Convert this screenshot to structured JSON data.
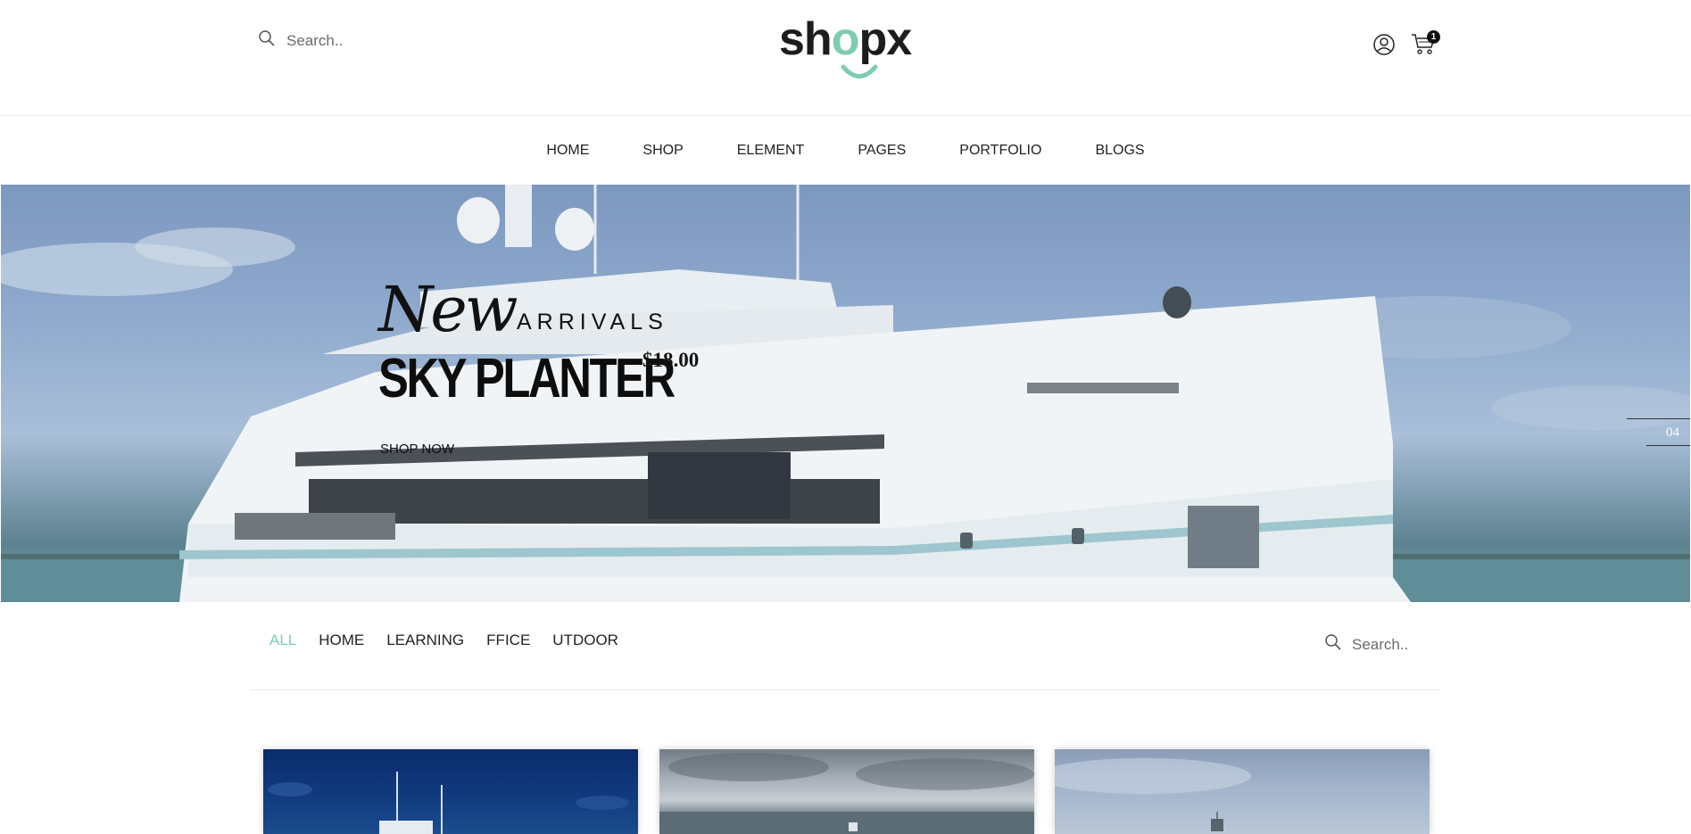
{
  "header": {
    "search_placeholder": "Search..",
    "logo_text": "shopx",
    "cart_count": "1",
    "icons": {
      "search": "search-icon",
      "account": "user-circle-icon",
      "cart": "cart-icon"
    }
  },
  "nav": {
    "items": [
      {
        "label": "HOME"
      },
      {
        "label": "SHOP"
      },
      {
        "label": "ELEMENT"
      },
      {
        "label": "PAGES"
      },
      {
        "label": "PORTFOLIO"
      },
      {
        "label": "BLOGS"
      }
    ]
  },
  "hero": {
    "script_text": "New",
    "subtitle": "ARRIVALS",
    "title": "SKY PLANTER",
    "price": "$18.00",
    "cta": "SHOP NOW",
    "slide_number": "04"
  },
  "filters": {
    "items": [
      {
        "label": "ALL",
        "active": true
      },
      {
        "label": "HOME"
      },
      {
        "label": "LEARNING"
      },
      {
        "label": "FFICE"
      },
      {
        "label": "UTDOOR"
      }
    ],
    "search_placeholder": "Search.."
  },
  "colors": {
    "accent": "#7fcbb3",
    "text": "#222222"
  }
}
